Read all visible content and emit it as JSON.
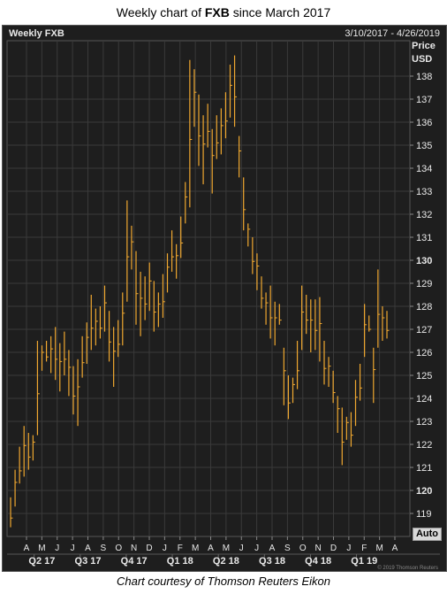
{
  "title": {
    "prefix": "Weekly chart of ",
    "ticker": "FXB",
    "suffix": " since March 2017"
  },
  "caption": "Chart courtesy of Thomson Reuters Eikon",
  "watermark": "© 2019 Thomson Reuters",
  "auto_label": "Auto",
  "chart_data": {
    "type": "ohlc",
    "title": "Weekly FXB",
    "date_range": "3/10/2017 - 4/26/2019",
    "ylabel": "Price",
    "unit": "USD",
    "ylim": [
      118.2,
      139.2
    ],
    "y_ticks": [
      119,
      120,
      121,
      122,
      123,
      124,
      125,
      126,
      127,
      128,
      129,
      130,
      131,
      132,
      133,
      134,
      135,
      136,
      137,
      138
    ],
    "y_ticks_bold": [
      120,
      130
    ],
    "month_labels": [
      "A",
      "M",
      "J",
      "J",
      "A",
      "S",
      "O",
      "N",
      "D",
      "J",
      "F",
      "M",
      "A",
      "M",
      "J",
      "J",
      "A",
      "S",
      "O",
      "N",
      "D",
      "J",
      "F",
      "M",
      "A"
    ],
    "quarter_labels": [
      "Q2 17",
      "Q3 17",
      "Q4 17",
      "Q1 18",
      "Q2 18",
      "Q3 18",
      "Q4 18",
      "Q1 19"
    ],
    "colors": {
      "background": "#1e1e1e",
      "bars": "#f0a830",
      "grid": "#3a3a3a",
      "text": "#e8e8e8"
    },
    "grid": true,
    "series": [
      {
        "values": [
          {
            "h": 119.7,
            "l": 118.4
          },
          {
            "h": 120.9,
            "l": 119.3
          },
          {
            "h": 121.9,
            "l": 120.3
          },
          {
            "h": 122.8,
            "l": 120.6
          },
          {
            "h": 122.5,
            "l": 120.9
          },
          {
            "h": 122.4,
            "l": 121.3
          },
          {
            "h": 126.5,
            "l": 122.4
          },
          {
            "h": 126.3,
            "l": 125.2
          },
          {
            "h": 126.5,
            "l": 125.6
          },
          {
            "h": 126.7,
            "l": 125.1
          },
          {
            "h": 127.1,
            "l": 124.8
          },
          {
            "h": 126.4,
            "l": 124.3
          },
          {
            "h": 126.9,
            "l": 125.0
          },
          {
            "h": 126.1,
            "l": 124.1
          },
          {
            "h": 125.4,
            "l": 123.3
          },
          {
            "h": 125.7,
            "l": 122.8
          },
          {
            "h": 126.7,
            "l": 124.9
          },
          {
            "h": 127.3,
            "l": 125.5
          },
          {
            "h": 128.5,
            "l": 126.1
          },
          {
            "h": 127.9,
            "l": 126.3
          },
          {
            "h": 128.0,
            "l": 126.6
          },
          {
            "h": 128.9,
            "l": 126.9
          },
          {
            "h": 127.8,
            "l": 125.6
          },
          {
            "h": 127.1,
            "l": 124.5
          },
          {
            "h": 127.4,
            "l": 125.8
          },
          {
            "h": 128.6,
            "l": 126.3
          },
          {
            "h": 132.6,
            "l": 128.2
          },
          {
            "h": 131.5,
            "l": 129.6
          },
          {
            "h": 130.4,
            "l": 127.2
          },
          {
            "h": 129.5,
            "l": 126.7
          },
          {
            "h": 129.3,
            "l": 127.4
          },
          {
            "h": 129.9,
            "l": 127.8
          },
          {
            "h": 129.1,
            "l": 126.9
          },
          {
            "h": 128.6,
            "l": 127.1
          },
          {
            "h": 129.4,
            "l": 127.5
          },
          {
            "h": 130.3,
            "l": 128.6
          },
          {
            "h": 131.3,
            "l": 129.5
          },
          {
            "h": 130.7,
            "l": 129.2
          },
          {
            "h": 131.9,
            "l": 130.1
          },
          {
            "h": 133.4,
            "l": 131.6
          },
          {
            "h": 138.7,
            "l": 132.3
          },
          {
            "h": 138.3,
            "l": 135.8
          },
          {
            "h": 137.2,
            "l": 134.1
          },
          {
            "h": 136.3,
            "l": 133.3
          },
          {
            "h": 136.8,
            "l": 134.9
          },
          {
            "h": 135.7,
            "l": 132.9
          },
          {
            "h": 136.3,
            "l": 134.4
          },
          {
            "h": 136.6,
            "l": 134.6
          },
          {
            "h": 137.3,
            "l": 135.3
          },
          {
            "h": 138.5,
            "l": 136.2
          },
          {
            "h": 138.9,
            "l": 135.8
          },
          {
            "h": 135.4,
            "l": 133.6
          },
          {
            "h": 133.6,
            "l": 131.3
          },
          {
            "h": 131.6,
            "l": 130.6
          },
          {
            "h": 131.0,
            "l": 129.4
          },
          {
            "h": 130.3,
            "l": 128.7
          },
          {
            "h": 129.3,
            "l": 127.9
          },
          {
            "h": 128.6,
            "l": 127.2
          },
          {
            "h": 128.9,
            "l": 126.6
          },
          {
            "h": 128.2,
            "l": 126.3
          },
          {
            "h": 128.1,
            "l": 127.2
          },
          {
            "h": 126.2,
            "l": 123.7
          },
          {
            "h": 125.0,
            "l": 123.1
          },
          {
            "h": 124.9,
            "l": 123.8
          },
          {
            "h": 126.5,
            "l": 124.4
          },
          {
            "h": 128.9,
            "l": 126.1
          },
          {
            "h": 128.5,
            "l": 126.8
          },
          {
            "h": 128.3,
            "l": 126.0
          },
          {
            "h": 128.3,
            "l": 126.1
          },
          {
            "h": 128.4,
            "l": 125.6
          },
          {
            "h": 126.5,
            "l": 124.6
          },
          {
            "h": 125.8,
            "l": 124.5
          },
          {
            "h": 125.2,
            "l": 123.8
          },
          {
            "h": 124.1,
            "l": 122.5
          },
          {
            "h": 123.6,
            "l": 121.1
          },
          {
            "h": 123.2,
            "l": 122.2
          },
          {
            "h": 123.4,
            "l": 121.9
          },
          {
            "h": 124.8,
            "l": 122.8
          },
          {
            "h": 125.5,
            "l": 123.9
          },
          {
            "h": 128.1,
            "l": 125.8
          },
          {
            "h": 127.6,
            "l": 126.9
          },
          {
            "h": 126.2,
            "l": 123.8
          },
          {
            "h": 129.6,
            "l": 126.2
          },
          {
            "h": 128.0,
            "l": 126.5
          },
          {
            "h": 127.8,
            "l": 126.6
          }
        ]
      }
    ]
  }
}
